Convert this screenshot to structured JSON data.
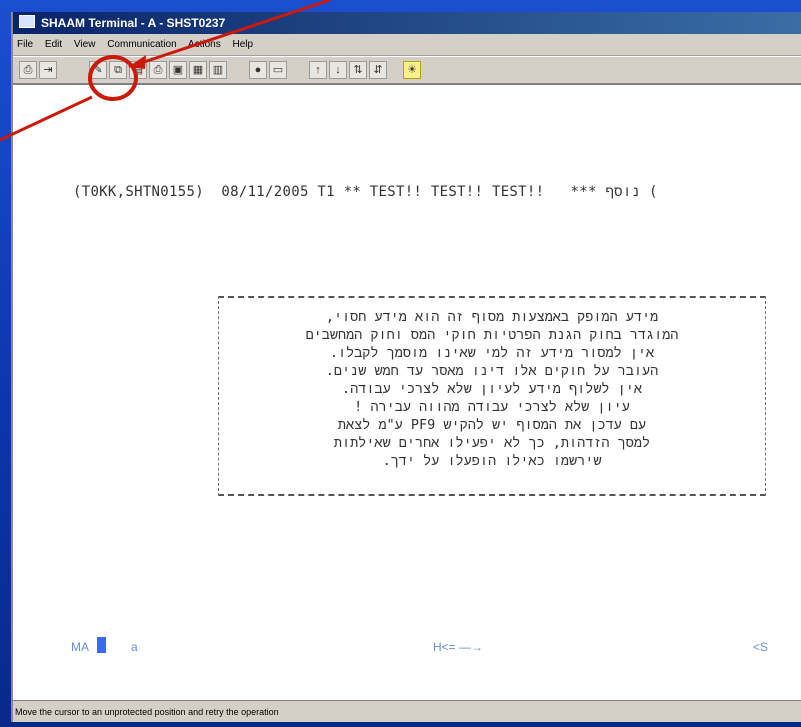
{
  "window": {
    "title": "SHAAM Terminal - A - SHST0237"
  },
  "menu": [
    "File",
    "Edit",
    "View",
    "Communication",
    "Actions",
    "Help"
  ],
  "toolbar": {
    "buttons": [
      "print-icon",
      "exit-icon",
      "connect-icon",
      "copy-icon",
      "paste-icon",
      "print-screen-icon",
      "macro-icon",
      "settings-icon",
      "clipboard-icon",
      "record-icon",
      "keyboard-icon",
      "send-icon",
      "receive-icon",
      "transfer-icon",
      "transfer-alt-icon",
      "help-bulb-icon"
    ]
  },
  "terminal": {
    "header_line": "(T0KK,SHTN0155)  08/11/2005 T1 ** TEST!! TEST!! TEST!!   *** נוסף (",
    "notice_lines": [
      "מידע המופק באמצעות מסוף זה הוא מידע חסוי,",
      "המוגדר בחוק הגנת הפרטיות חוקי המס וחוק המחשבים",
      "אין למסור מידע זה למי שאינו מוסמך לקבלו.",
      "העובר על חוקים אלו דינו מאסר עד חמש שנים.",
      "אין לשלוף מידע לעיון שלא לצרכי עבודה.",
      "עיון שלא לצרכי עבודה מהווה עבירה !",
      "עם עדכן את המסוף יש להקיש PF9 ע\"מ לצאת",
      "למסך הזדהות, כך לא יפעילו אחרים שאילתות",
      "שירשמו כאילו הופעלו על ידך."
    ]
  },
  "status": {
    "left_label": "MA",
    "field_a": "a",
    "mid_label": "H<= —→",
    "right_label": "<S"
  },
  "message_bar": "Move the cursor to an unprotected position and retry the operation",
  "colors": {
    "desktop_blue": "#0c36ad",
    "highlight_red": "#cc1a0a"
  }
}
